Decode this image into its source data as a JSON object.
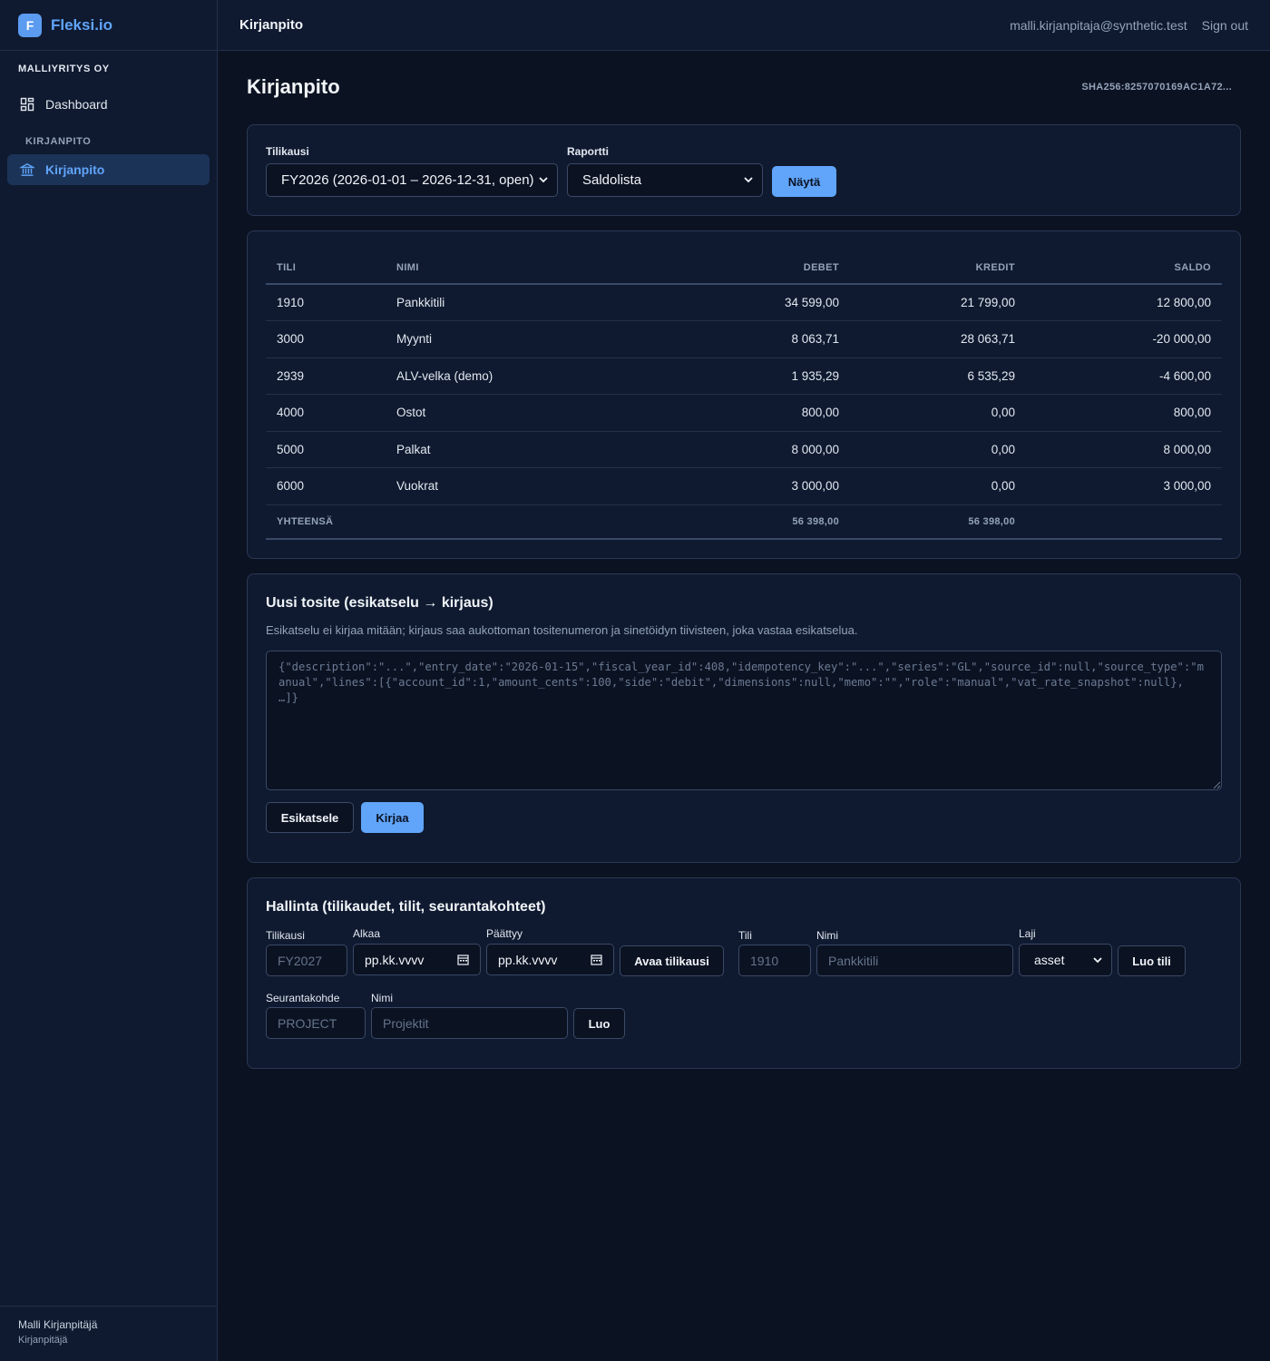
{
  "brand": {
    "logo_letter": "F",
    "name": "Fleksi.io",
    "accent": "#60a5fa"
  },
  "sidebar": {
    "company": "MALLIYRITYS OY",
    "items": [
      {
        "label": "Dashboard",
        "icon": "dashboard-icon"
      },
      {
        "label": "Kirjanpito",
        "icon": "bank-icon"
      }
    ],
    "section": "KIRJANPITO",
    "user": {
      "name": "Malli Kirjanpitäjä",
      "role": "Kirjanpitäjä"
    }
  },
  "topbar": {
    "title": "Kirjanpito",
    "email": "malli.kirjanpitaja@synthetic.test",
    "signout": "Sign out"
  },
  "page": {
    "title": "Kirjanpito",
    "hash": "SHA256:8257070169AC1A72..."
  },
  "filters": {
    "fiscal_label": "Tilikausi",
    "fiscal_value": "FY2026 (2026-01-01 – 2026-12-31, open)",
    "report_label": "Raportti",
    "report_value": "Saldolista",
    "show_button": "Näytä"
  },
  "table": {
    "columns": [
      "TILI",
      "NIMI",
      "DEBET",
      "KREDIT",
      "SALDO"
    ],
    "rows": [
      [
        "1910",
        "Pankkitili",
        "34 599,00",
        "21 799,00",
        "12 800,00"
      ],
      [
        "3000",
        "Myynti",
        "8 063,71",
        "28 063,71",
        "-20 000,00"
      ],
      [
        "2939",
        "ALV-velka (demo)",
        "1 935,29",
        "6 535,29",
        "-4 600,00"
      ],
      [
        "4000",
        "Ostot",
        "800,00",
        "0,00",
        "800,00"
      ],
      [
        "5000",
        "Palkat",
        "8 000,00",
        "0,00",
        "8 000,00"
      ],
      [
        "6000",
        "Vuokrat",
        "3 000,00",
        "0,00",
        "3 000,00"
      ]
    ],
    "total": {
      "label": "YHTEENSÄ",
      "debet": "56 398,00",
      "kredit": "56 398,00"
    }
  },
  "voucher": {
    "title": "Uusi tosite (esikatselu → kirjaus)",
    "description": "Esikatselu ei kirjaa mitään; kirjaus saa aukottoman tositenumeron ja sinetöidyn tiivisteen, joka vastaa esikatselua.",
    "placeholder": "{\"description\":\"...\",\"entry_date\":\"2026-01-15\",\"fiscal_year_id\":408,\"idempotency_key\":\"...\",\"series\":\"GL\",\"source_id\":null,\"source_type\":\"manual\",\"lines\":[{\"account_id\":1,\"amount_cents\":100,\"side\":\"debit\",\"dimensions\":null,\"memo\":\"\",\"role\":\"manual\",\"vat_rate_snapshot\":null}, …]}",
    "preview_button": "Esikatsele",
    "post_button": "Kirjaa"
  },
  "admin": {
    "title": "Hallinta (tilikaudet, tilit, seurantakohteet)",
    "fiscal": {
      "label": "Tilikausi",
      "placeholder": "FY2027",
      "start_label": "Alkaa",
      "start_value": "pp.kk.vvvv",
      "end_label": "Päättyy",
      "end_value": "pp.kk.vvvv",
      "button": "Avaa tilikausi"
    },
    "account": {
      "number_label": "Tili",
      "number_placeholder": "1910",
      "name_label": "Nimi",
      "name_placeholder": "Pankkitili",
      "type_label": "Laji",
      "type_value": "asset",
      "button": "Luo tili"
    },
    "dimension": {
      "label": "Seurantakohde",
      "placeholder": "PROJECT",
      "name_label": "Nimi",
      "name_placeholder": "Projektit",
      "button": "Luo"
    }
  }
}
